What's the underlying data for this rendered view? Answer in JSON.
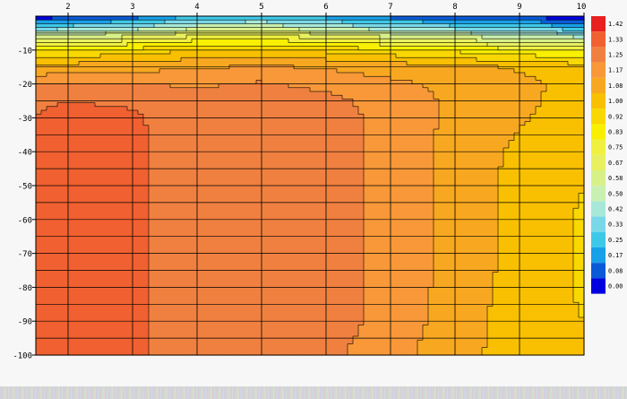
{
  "chart_data": {
    "type": "heatmap",
    "subtype": "filled-contour",
    "title": "",
    "xlabel": "",
    "ylabel": "",
    "xlim": [
      1.5,
      10
    ],
    "ylim": [
      -100,
      0
    ],
    "x_ticks": [
      "2",
      "3",
      "4",
      "5",
      "6",
      "7",
      "8",
      "9",
      "10"
    ],
    "y_ticks": [
      "-10",
      "-20",
      "-30",
      "-40",
      "-50",
      "-60",
      "-70",
      "-80",
      "-90",
      "-100"
    ],
    "y_tick_values": [
      -10,
      -20,
      -30,
      -40,
      -50,
      -60,
      -70,
      -80,
      -90,
      -100
    ],
    "x": [
      1.5,
      2,
      3,
      4,
      5,
      6,
      7,
      8,
      9,
      10
    ],
    "y": [
      0,
      -5,
      -10,
      -15,
      -20,
      -25,
      -30,
      -40,
      -50,
      -60,
      -70,
      -80,
      -90,
      -100
    ],
    "z": [
      [
        0.0,
        0.05,
        0.1,
        0.25,
        0.28,
        0.2,
        0.12,
        0.08,
        0.05,
        0.02
      ],
      [
        0.5,
        0.55,
        0.6,
        0.7,
        0.72,
        0.65,
        0.58,
        0.52,
        0.45,
        0.4
      ],
      [
        0.9,
        0.92,
        0.95,
        1.0,
        1.02,
        0.98,
        0.94,
        0.9,
        0.86,
        0.82
      ],
      [
        1.1,
        1.12,
        1.14,
        1.16,
        1.18,
        1.16,
        1.13,
        1.1,
        1.07,
        1.04
      ],
      [
        1.24,
        1.26,
        1.25,
        1.24,
        1.26,
        1.23,
        1.19,
        1.15,
        1.1,
        1.05
      ],
      [
        1.32,
        1.33,
        1.32,
        1.28,
        1.28,
        1.27,
        1.22,
        1.15,
        1.1,
        1.04
      ],
      [
        1.33,
        1.35,
        1.34,
        1.29,
        1.28,
        1.28,
        1.23,
        1.15,
        1.09,
        1.03
      ],
      [
        1.33,
        1.35,
        1.34,
        1.3,
        1.29,
        1.29,
        1.22,
        1.14,
        1.06,
        1.01
      ],
      [
        1.33,
        1.35,
        1.34,
        1.3,
        1.29,
        1.29,
        1.22,
        1.14,
        1.05,
        1.0
      ],
      [
        1.33,
        1.35,
        1.34,
        1.3,
        1.29,
        1.29,
        1.22,
        1.14,
        1.05,
        0.99
      ],
      [
        1.33,
        1.35,
        1.34,
        1.3,
        1.29,
        1.29,
        1.22,
        1.14,
        1.05,
        0.99
      ],
      [
        1.33,
        1.35,
        1.34,
        1.3,
        1.29,
        1.29,
        1.22,
        1.14,
        1.04,
        0.99
      ],
      [
        1.33,
        1.35,
        1.34,
        1.3,
        1.29,
        1.29,
        1.22,
        1.13,
        1.03,
        1.0
      ],
      [
        1.33,
        1.35,
        1.34,
        1.3,
        1.29,
        1.27,
        1.2,
        1.12,
        1.03,
        1.0
      ]
    ],
    "colorbar": {
      "levels": [
        "0.00",
        "0.08",
        "0.17",
        "0.25",
        "0.33",
        "0.42",
        "0.50",
        "0.58",
        "0.67",
        "0.75",
        "0.83",
        "0.92",
        "1.00",
        "1.08",
        "1.17",
        "1.25",
        "1.33",
        "1.42"
      ],
      "level_values": [
        0.0,
        0.08,
        0.17,
        0.25,
        0.33,
        0.42,
        0.5,
        0.58,
        0.67,
        0.75,
        0.83,
        0.92,
        1.0,
        1.08,
        1.17,
        1.25,
        1.33,
        1.42
      ],
      "colors": [
        "#0000e0",
        "#0a5ad8",
        "#18a0e8",
        "#3ec8e8",
        "#78d8e8",
        "#a8e8d8",
        "#c8f0b0",
        "#d8f088",
        "#e8f060",
        "#f0f040",
        "#f8f000",
        "#f8d800",
        "#f8c000",
        "#f8a820",
        "#f89838",
        "#f08040",
        "#f06030",
        "#e82020"
      ]
    },
    "grid": true
  }
}
